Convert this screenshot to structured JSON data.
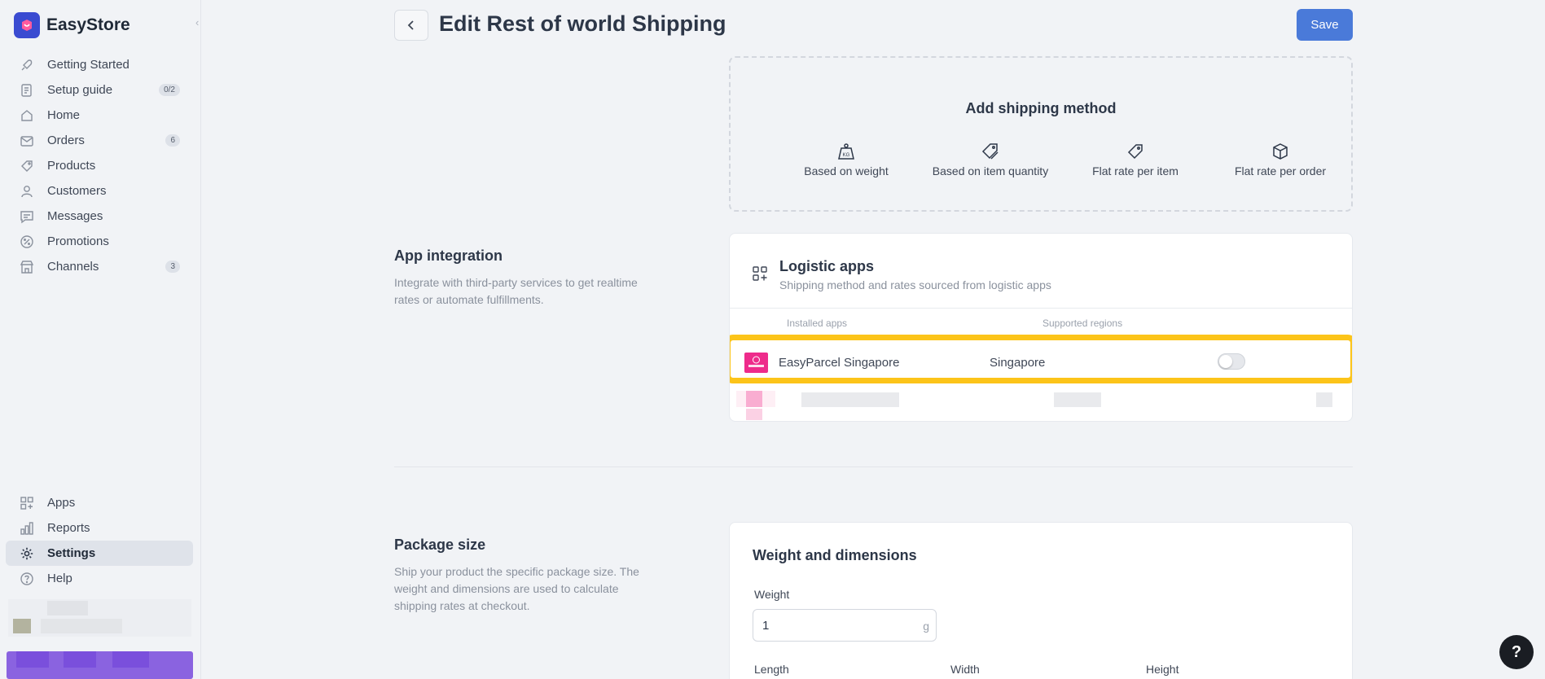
{
  "brand": {
    "name": "EasyStore"
  },
  "sidebar": {
    "items": [
      {
        "label": "Getting Started",
        "icon": "rocket-icon",
        "badge": ""
      },
      {
        "label": "Setup guide",
        "icon": "checklist-icon",
        "badge": "0/2"
      },
      {
        "label": "Home",
        "icon": "home-icon",
        "badge": ""
      },
      {
        "label": "Orders",
        "icon": "inbox-icon",
        "badge": "6"
      },
      {
        "label": "Products",
        "icon": "tag-icon",
        "badge": ""
      },
      {
        "label": "Customers",
        "icon": "user-icon",
        "badge": ""
      },
      {
        "label": "Messages",
        "icon": "chat-icon",
        "badge": ""
      },
      {
        "label": "Promotions",
        "icon": "percent-icon",
        "badge": ""
      },
      {
        "label": "Channels",
        "icon": "store-icon",
        "badge": "3"
      }
    ],
    "bottom_items": [
      {
        "label": "Apps",
        "icon": "apps-icon"
      },
      {
        "label": "Reports",
        "icon": "bar-chart-icon"
      },
      {
        "label": "Settings",
        "icon": "gear-icon",
        "active": true
      },
      {
        "label": "Help",
        "icon": "help-circle-icon"
      }
    ]
  },
  "header": {
    "title": "Edit Rest of world Shipping",
    "save_label": "Save"
  },
  "add_shipping": {
    "title": "Add shipping method",
    "methods": [
      {
        "label": "Based on weight",
        "icon": "weight-icon"
      },
      {
        "label": "Based on item quantity",
        "icon": "tags-icon"
      },
      {
        "label": "Flat rate per item",
        "icon": "tag-icon"
      },
      {
        "label": "Flat rate per order",
        "icon": "box-icon"
      }
    ]
  },
  "app_integration": {
    "title": "App integration",
    "description": "Integrate with third-party services to get realtime rates or automate fulfillments.",
    "card": {
      "title": "Logistic apps",
      "subtitle": "Shipping method and rates sourced from logistic apps",
      "col_installed": "Installed apps",
      "col_regions": "Supported regions",
      "apps": [
        {
          "name": "EasyParcel Singapore",
          "region": "Singapore",
          "enabled": false
        }
      ]
    }
  },
  "package_size": {
    "title": "Package size",
    "description": "Ship your product the specific package size. The weight and dimensions are used to calculate shipping rates at checkout.",
    "card": {
      "title": "Weight and dimensions",
      "weight_label": "Weight",
      "weight_value": "1",
      "weight_unit": "g",
      "length_label": "Length",
      "width_label": "Width",
      "height_label": "Height"
    }
  },
  "help_button": {
    "label": "?"
  },
  "colors": {
    "accent": "#4a7ad9",
    "highlight": "#fcc419",
    "brand": "#3a4bd1",
    "app_logo": "#ee2b8b"
  }
}
